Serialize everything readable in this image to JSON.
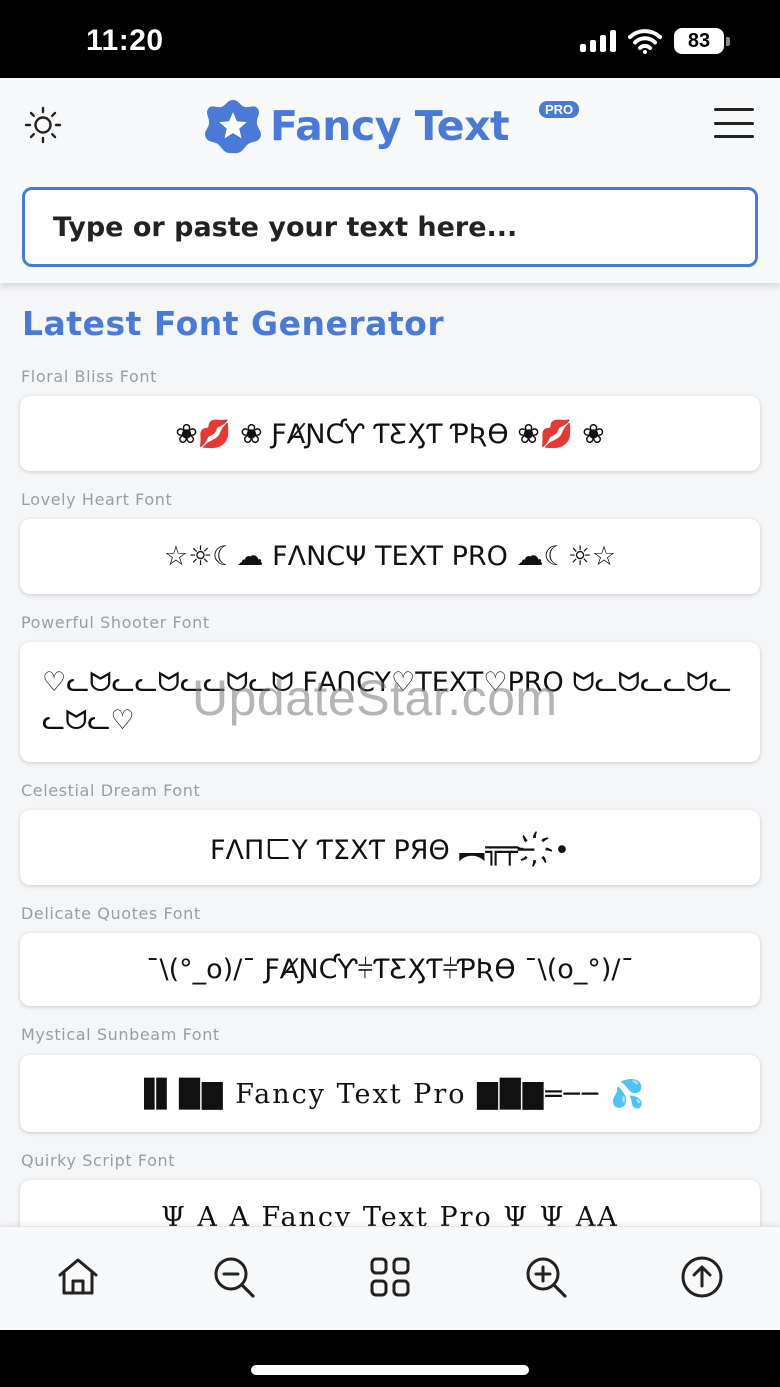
{
  "status_bar": {
    "time": "11:20",
    "battery": "83"
  },
  "header": {
    "logo_text": "Fancy Text",
    "logo_badge": "PRO"
  },
  "input": {
    "placeholder": "Type or paste your text here..."
  },
  "section_title": "Latest Font Generator",
  "fonts": [
    {
      "label": "Floral Bliss Font",
      "sample": "❀💋 ❀ ƑȺƝƇƳ ƬƸӼƬ ƤƦƟ ❀💋 ❀"
    },
    {
      "label": "Lovely Heart Font",
      "sample": "☆☼☾☁ FΛNCΨ TEXT PRO ☁☾☼☆"
    },
    {
      "label": "Powerful Shooter Font",
      "sample": "♡ᓚᗢᓚᓚᗢᓚᓚᗢᓚᗢ FΑՈCY♡TEXT♡PRO ᗢᓚᗢᓚᓚᗢᓚᓚᗢᓚ♡"
    },
    {
      "label": "Celestial Dream Font",
      "sample": "FΛПㄈY ƬΣXƬ PЯΘ ︻╦╤─ ҉•"
    },
    {
      "label": "Delicate Quotes Font",
      "sample": "¯\\(°_o)/¯ ƑȺƝƇƳ⫩ƬƸӼƬ⫩ƤƦƟ ¯\\(o_°)/¯"
    },
    {
      "label": "Mystical Sunbeam Font",
      "sample": "▐▌█▇ Fancy Text Pro ▇█▇═── 💦"
    },
    {
      "label": "Quirky Script Font",
      "sample": "Ψ A A Fancy Text Pro Ψ Ψ AA"
    }
  ],
  "watermark": "UpdateStar.com",
  "bottom_nav": [
    {
      "name": "home-icon"
    },
    {
      "name": "zoom-out-icon"
    },
    {
      "name": "grid-icon"
    },
    {
      "name": "zoom-in-icon"
    },
    {
      "name": "scroll-top-icon"
    }
  ],
  "colors": {
    "accent": "#4a7ad7",
    "label_gray": "#9a9da3",
    "background": "#f5f6f8"
  }
}
